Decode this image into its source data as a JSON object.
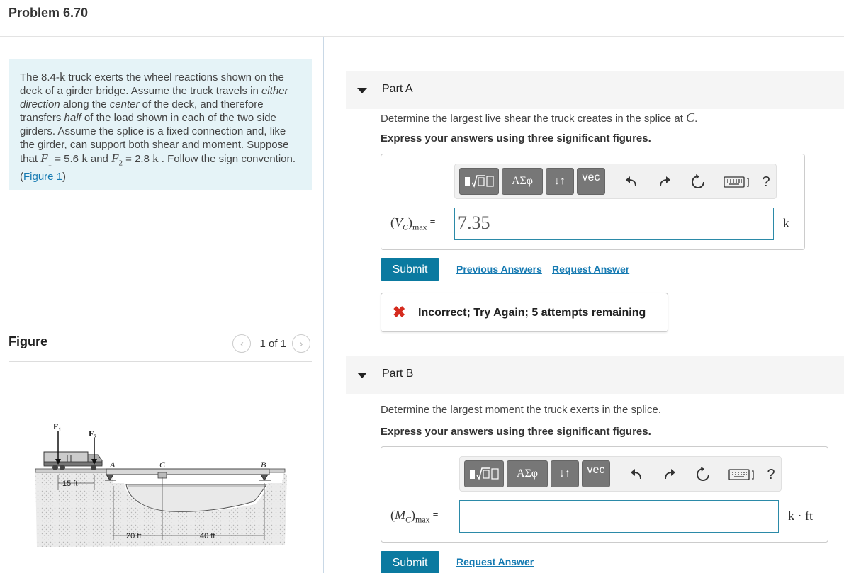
{
  "header": {
    "title": "Problem 6.70"
  },
  "problem": {
    "p1": "The 8.4-",
    "k1": "k",
    "p2": " truck exerts the wheel reactions shown on the deck of a girder bridge. Assume the truck travels in ",
    "i1": "either direction",
    "p3": " along the ",
    "i2": "center",
    "p4": " of the deck, and therefore transfers ",
    "i3": "half",
    "p5": " of the load shown in each of the two side girders. Assume the splice is a fixed connection and, like the girder, can support both shear and moment. Suppose that ",
    "f1": "F",
    "f1sub": "1",
    "p6": " = 5.6 ",
    "k2": "k",
    "p7": " and ",
    "f2": "F",
    "f2sub": "2",
    "p8": " = 2.8 ",
    "k3": "k",
    "p9": " . Follow the sign convention. (",
    "figure_link": "Figure 1",
    "p10": ")"
  },
  "figure_panel": {
    "title": "Figure",
    "pager": "1 of 1",
    "prev_icon": "chevron-left-icon",
    "next_icon": "chevron-right-icon",
    "labels": {
      "F1": "F",
      "F1sub": "1",
      "F2": "F",
      "F2sub": "2",
      "A": "A",
      "C": "C",
      "B": "B",
      "d15": "15 ft",
      "d20": "20 ft",
      "d40": "40 ft"
    }
  },
  "toolbar": {
    "templates_icon": "templates-icon",
    "greek": "ΑΣφ",
    "arrows": "↓↑",
    "vec": "vec",
    "undo_icon": "undo-icon",
    "redo_icon": "redo-icon",
    "reset_icon": "reset-icon",
    "keyboard_icon": "keyboard-icon",
    "help": "?"
  },
  "partA": {
    "title": "Part A",
    "question_pre": "Determine the largest live shear the truck creates in the splice at ",
    "question_var": "C",
    "question_post": ".",
    "instruction": "Express your answers using three significant figures.",
    "label_var": "V",
    "label_sub": "C",
    "label_max": "max",
    "equals": "=",
    "value": "7.35",
    "unit": "k",
    "submit": "Submit",
    "previous_answers": "Previous Answers",
    "request_answer": "Request Answer",
    "feedback": "Incorrect; Try Again; 5 attempts remaining",
    "feedback_icon": "x-icon"
  },
  "partB": {
    "title": "Part B",
    "question": "Determine the largest moment the truck exerts in the splice.",
    "instruction": "Express your answers using three significant figures.",
    "label_var": "M",
    "label_sub": "C",
    "label_max": "max",
    "equals": "=",
    "value": "",
    "unit": "k · ft",
    "submit": "Submit",
    "request_answer": "Request Answer"
  },
  "colors": {
    "accent": "#0b7aa0",
    "link": "#157ab2",
    "problem_bg": "#e5f3f7",
    "error": "#d52b1e"
  }
}
